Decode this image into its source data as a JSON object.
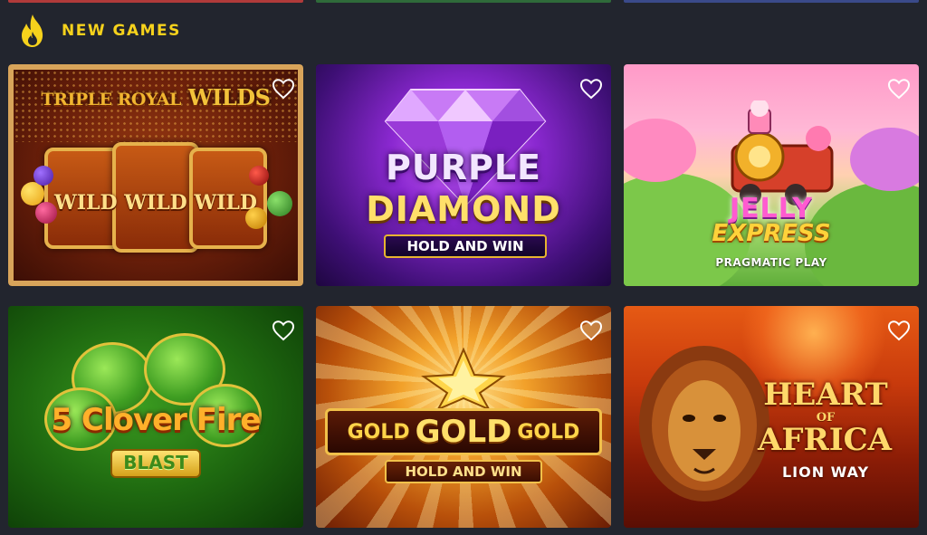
{
  "section": {
    "title": "NEW GAMES",
    "icon": "flame-icon",
    "accent_color": "#f6d21c"
  },
  "games": [
    {
      "id_label": "Triple Royal Wilds",
      "title_small": "TRIPLE ROYAL",
      "title_big": "WILDS",
      "wild_text": "WILD",
      "favorite_icon": "heart-outline-icon"
    },
    {
      "id_label": "Purple Diamond",
      "line1": "PURPLE",
      "line2": "DIAMOND",
      "badge": "HOLD AND WIN",
      "favorite_icon": "heart-outline-icon"
    },
    {
      "id_label": "Jelly Express",
      "line1": "JELLY",
      "line2": "EXPRESS",
      "provider": "PRAGMATIC PLAY",
      "favorite_icon": "heart-outline-icon"
    },
    {
      "id_label": "5 Clover Fire Blast",
      "line1": "5 Clover Fire",
      "badge": "BLAST",
      "favorite_icon": "heart-outline-icon"
    },
    {
      "id_label": "Gold Gold Gold",
      "word_left": "GOLD",
      "word_mid": "GOLD",
      "word_right": "GOLD",
      "badge": "HOLD AND WIN",
      "favorite_icon": "heart-outline-icon"
    },
    {
      "id_label": "Heart of Africa",
      "line1": "HEART",
      "line_of": "OF",
      "line2": "AFRICA",
      "subtitle": "LION WAY",
      "favorite_icon": "heart-outline-icon"
    }
  ]
}
